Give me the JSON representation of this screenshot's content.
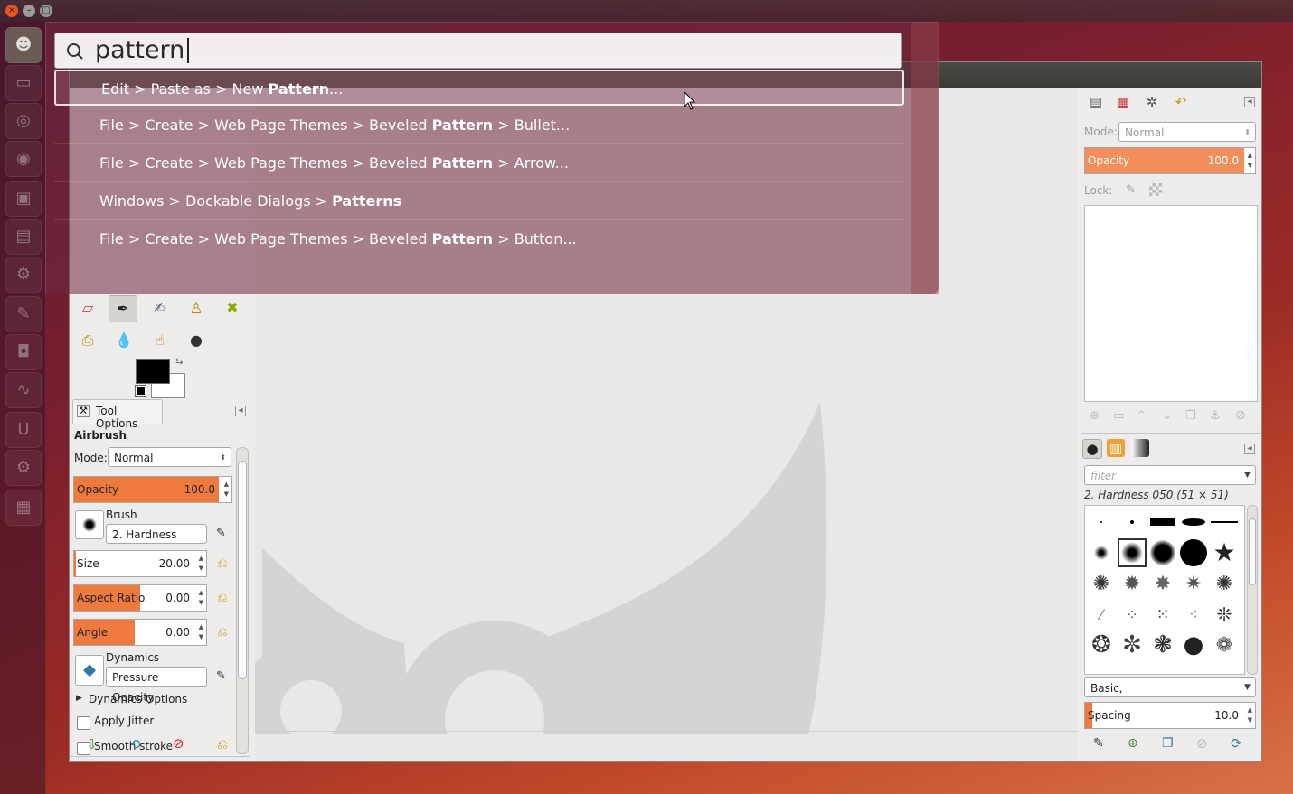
{
  "window_controls": {
    "close": "×",
    "minimize": "–",
    "maximize": "□"
  },
  "dash": {
    "search_value": "pattern",
    "results": [
      {
        "pre": "Edit > Paste as > New ",
        "bold": "Pattern",
        "post": "..."
      },
      {
        "pre": "File > Create > Web Page Themes > Beveled ",
        "bold": "Pattern",
        "post": " > Bullet..."
      },
      {
        "pre": "File > Create > Web Page Themes > Beveled ",
        "bold": "Pattern",
        "post": " > Arrow..."
      },
      {
        "pre": "Windows > Dockable Dialogs > ",
        "bold": "Patterns",
        "post": ""
      },
      {
        "pre": "File > Create > Web Page Themes > Beveled ",
        "bold": "Pattern",
        "post": " > Button..."
      }
    ]
  },
  "tool_options": {
    "tab_label": "Tool Options",
    "tool_name": "Airbrush",
    "mode_label": "Mode:",
    "mode_value": "Normal",
    "opacity_label": "Opacity",
    "opacity_value": "100.0",
    "opacity_fraction": 1.0,
    "brush_label": "Brush",
    "brush_value": "2. Hardness 050",
    "size_label": "Size",
    "size_value": "20.00",
    "aspect_label": "Aspect Ratio",
    "aspect_value": "0.00",
    "angle_label": "Angle",
    "angle_value": "0.00",
    "dynamics_label": "Dynamics",
    "dynamics_value": "Pressure Opacity",
    "dynamics_options_label": "Dynamics Options",
    "apply_jitter_label": "Apply Jitter",
    "smooth_stroke_label": "Smooth stroke"
  },
  "layers": {
    "mode_label": "Mode:",
    "mode_value": "Normal",
    "opacity_label": "Opacity",
    "opacity_value": "100.0",
    "lock_label": "Lock:"
  },
  "brushes": {
    "filter_placeholder": "filter",
    "current_brush": "2. Hardness 050 (51 × 51)",
    "tag_value": "Basic,",
    "spacing_label": "Spacing",
    "spacing_value": "10.0"
  },
  "colors": {
    "accent": "#ef7a3e",
    "fg": "#000000",
    "bg": "#ffffff"
  }
}
